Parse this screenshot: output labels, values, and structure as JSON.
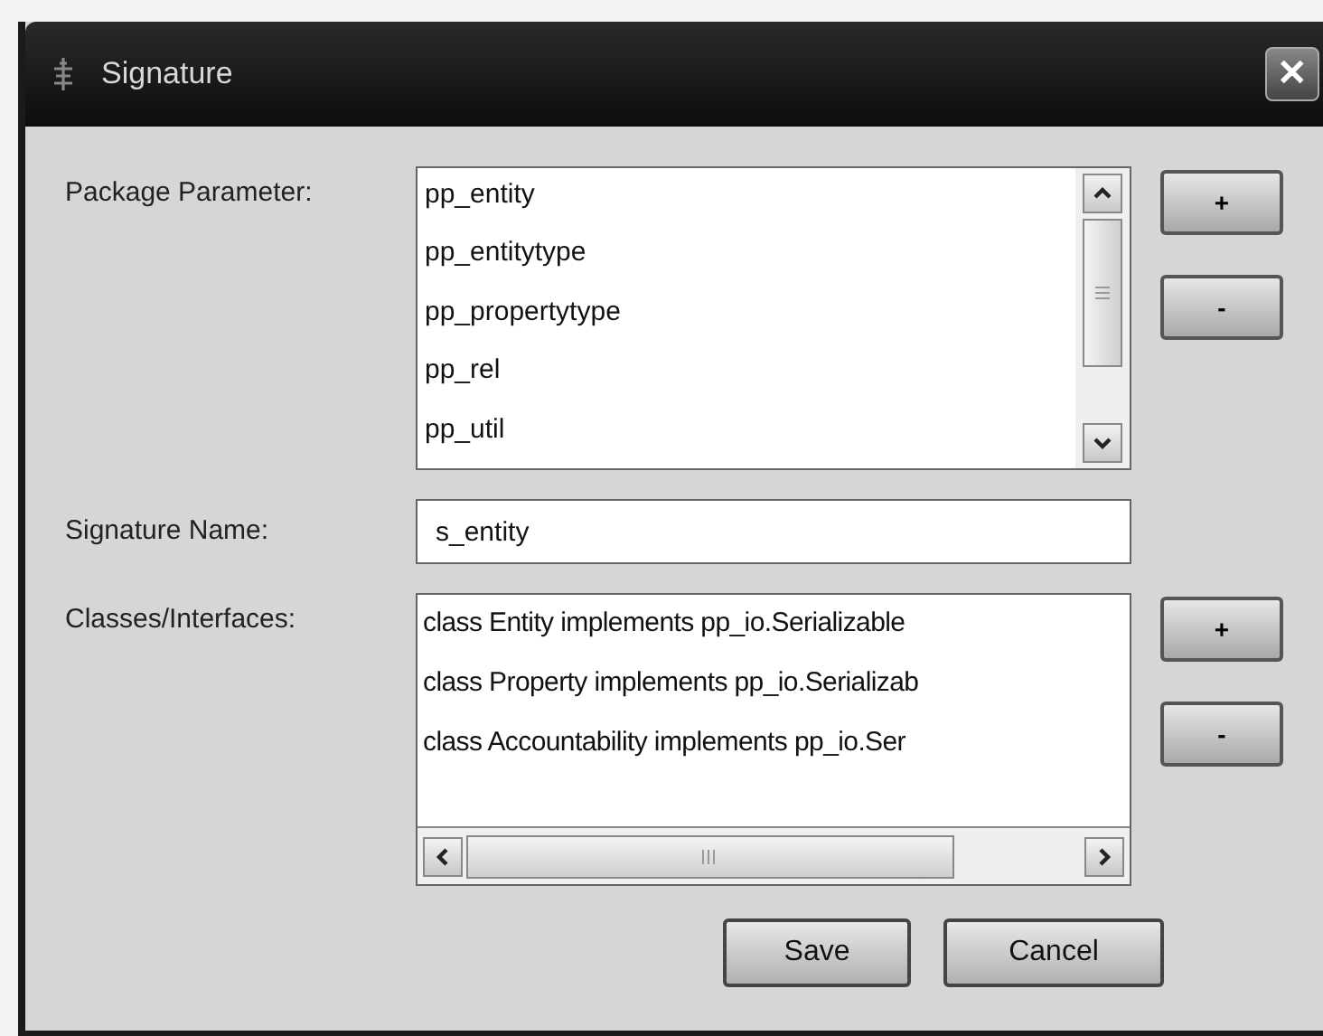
{
  "window": {
    "title": "Signature",
    "close": "✕"
  },
  "package_parameter": {
    "label": "Package Parameter:",
    "items": [
      "pp_entity",
      "pp_entitytype",
      "pp_propertytype",
      "pp_rel",
      "pp_util"
    ],
    "add": "+",
    "remove": "-"
  },
  "signature_name": {
    "label": "Signature Name:",
    "value": "s_entity"
  },
  "classes_interfaces": {
    "label": "Classes/Interfaces:",
    "items": [
      "class Entity implements pp_io.Serializable",
      "class Property implements pp_io.Serializab",
      "class Accountability implements pp_io.Ser"
    ],
    "add": "+",
    "remove": "-"
  },
  "buttons": [
    "Save",
    "Cancel"
  ]
}
